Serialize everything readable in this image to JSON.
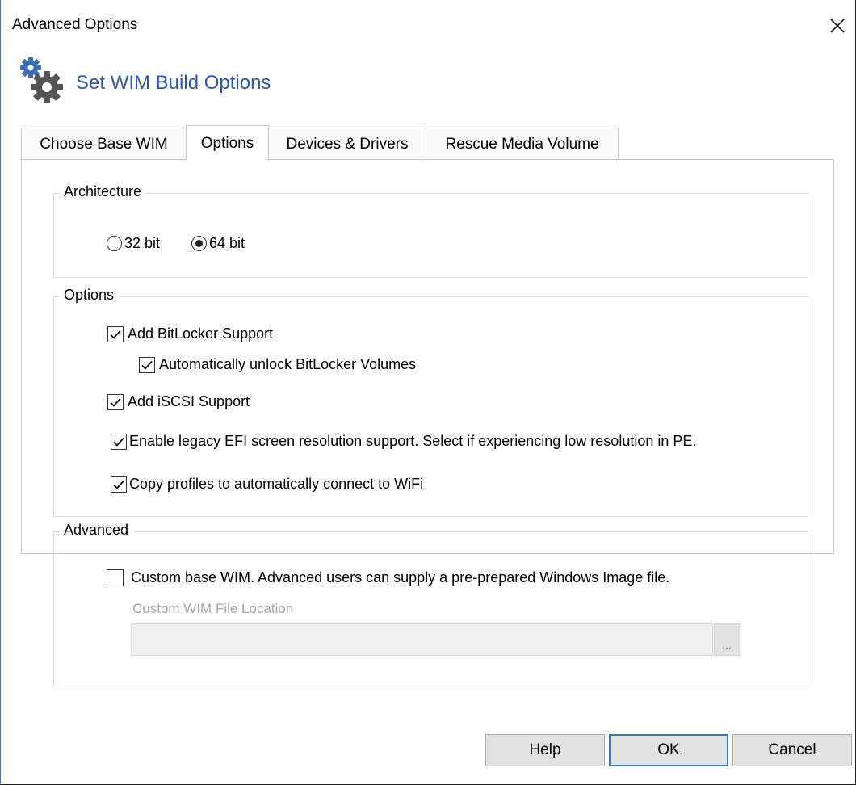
{
  "window": {
    "title": "Advanced Options"
  },
  "header": {
    "title": "Set WIM Build Options"
  },
  "tabs": [
    {
      "label": "Choose Base WIM"
    },
    {
      "label": "Options"
    },
    {
      "label": "Devices & Drivers"
    },
    {
      "label": "Rescue Media Volume"
    }
  ],
  "architecture": {
    "title": "Architecture",
    "options": [
      {
        "label": "32 bit",
        "selected": false
      },
      {
        "label": "64 bit",
        "selected": true
      }
    ]
  },
  "options_group": {
    "title": "Options",
    "bitlocker": "Add BitLocker Support",
    "auto_unlock": "Automatically unlock BitLocker Volumes",
    "iscsi": "Add iSCSI Support",
    "legacy_efi": "Enable legacy EFI screen resolution support.  Select if experiencing low resolution in PE.",
    "wifi": "Copy profiles to automatically connect to WiFi"
  },
  "advanced": {
    "title": "Advanced",
    "custom_wim": "Custom base WIM. Advanced users can supply a pre-prepared Windows Image file.",
    "location_label": "Custom WIM File Location",
    "location_value": "",
    "browse_label": "..."
  },
  "buttons": {
    "help": "Help",
    "ok": "OK",
    "cancel": "Cancel"
  }
}
